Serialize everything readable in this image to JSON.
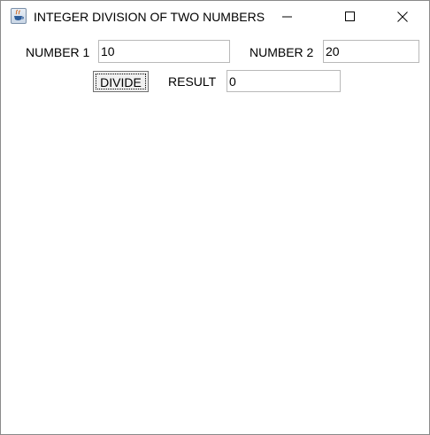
{
  "window": {
    "title": "INTEGER DIVISION OF TWO NUMBERS",
    "icon": "java-cup-icon"
  },
  "form": {
    "number1_label": "NUMBER 1",
    "number1_value": "10",
    "number2_label": "NUMBER 2",
    "number2_value": "20",
    "divide_label": "DIVIDE",
    "result_label": "RESULT",
    "result_value": "0"
  }
}
